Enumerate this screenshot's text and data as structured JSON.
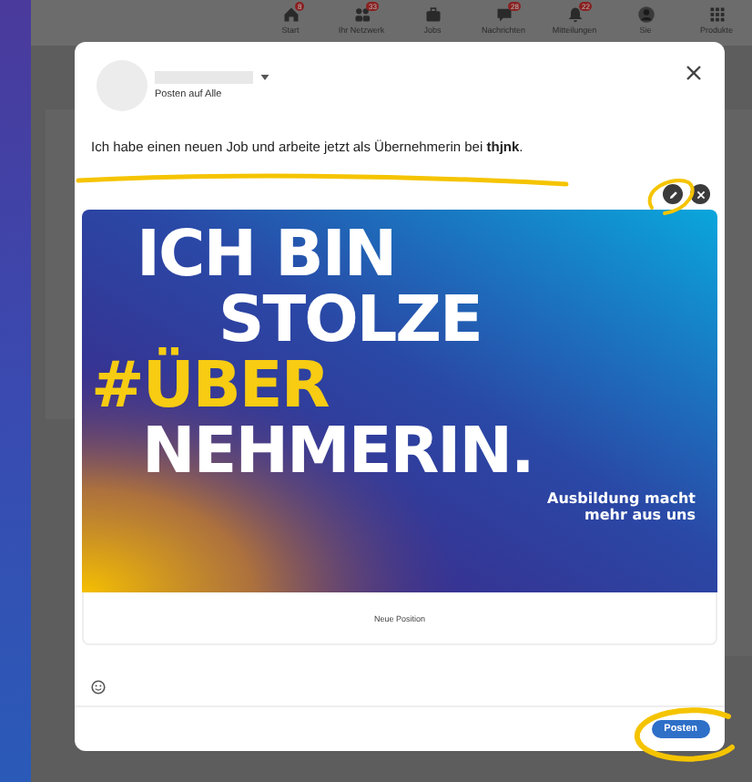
{
  "nav": {
    "items": [
      {
        "kind": "home",
        "label": "Start",
        "badge": "8"
      },
      {
        "kind": "network",
        "label": "Ihr Netzwerk",
        "badge": "33"
      },
      {
        "kind": "jobs",
        "label": "Jobs"
      },
      {
        "kind": "messages",
        "label": "Nachrichten",
        "badge": "28"
      },
      {
        "kind": "notifications",
        "label": "Mitteilungen",
        "badge": "22"
      },
      {
        "kind": "profile",
        "label": "Sie"
      },
      {
        "kind": "products",
        "label": "Produkte"
      }
    ]
  },
  "dialog": {
    "audience": "Posten auf Alle",
    "post_text": "Ich habe einen neuen Job und arbeite jetzt als Übernehmerin bei **thjnk**.",
    "image": {
      "headline": [
        {
          "text": "ICH BIN",
          "highlight": false
        },
        {
          "text": "STOLZE",
          "highlight": false
        },
        {
          "text": "#ÜBER",
          "highlight": true
        },
        {
          "text": "NEHMERIN.",
          "highlight": false
        }
      ],
      "tagline": "Ausbildung macht mehr aus uns"
    },
    "caption": "Neue Position",
    "submit": "Posten"
  }
}
